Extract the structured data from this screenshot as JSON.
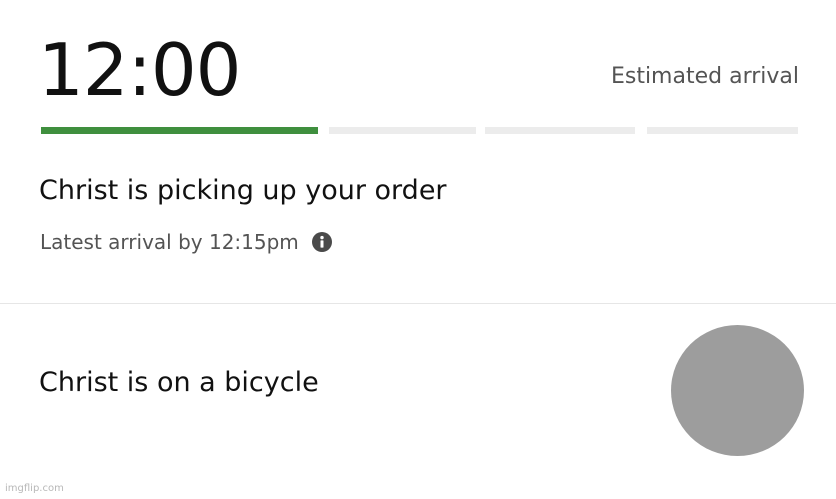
{
  "eta": {
    "time": "12:00",
    "label": "Estimated arrival"
  },
  "progress": {
    "segments": [
      {
        "fill": 1.0
      },
      {
        "fill": 0.0
      },
      {
        "fill": 0.0
      },
      {
        "fill": 0.0
      }
    ],
    "active_color": "#3f8f3e",
    "inactive_color": "#ececec"
  },
  "status": {
    "title": "Christ is picking up your order",
    "latest_arrival": "Latest arrival by 12:15pm",
    "info_icon": "info-icon"
  },
  "courier": {
    "vehicle_text": "Christ is on a bicycle",
    "avatar_color": "#9d9d9d"
  },
  "watermark": "imgflip.com"
}
